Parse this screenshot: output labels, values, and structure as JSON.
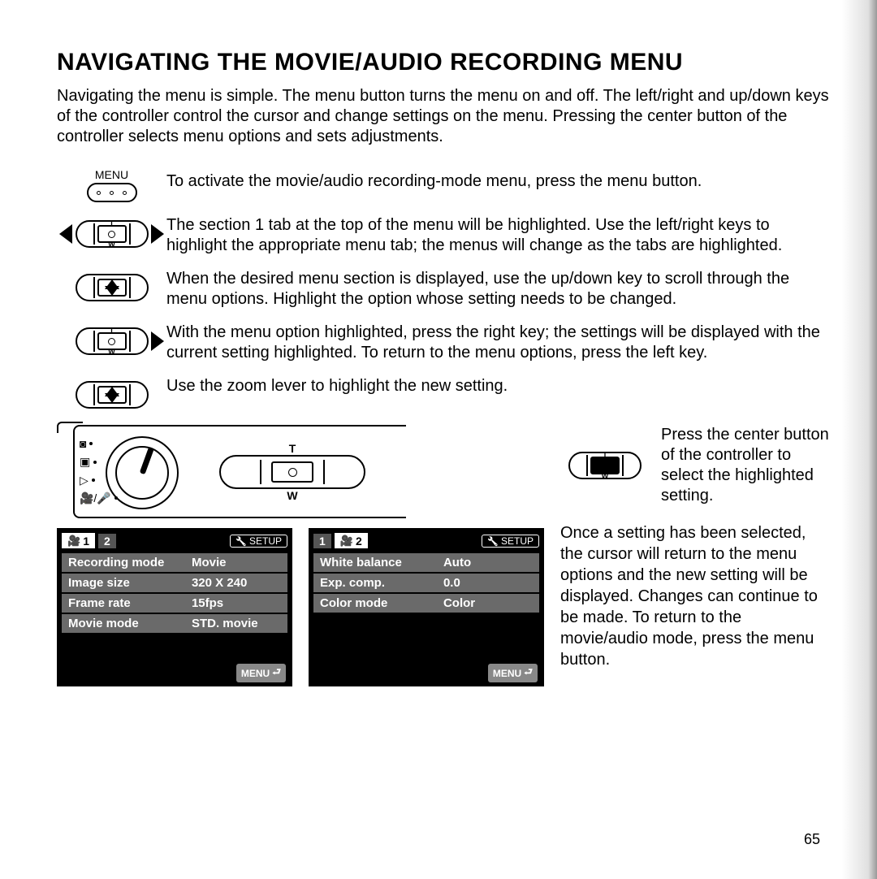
{
  "title": "NAVIGATING THE MOVIE/AUDIO RECORDING MENU",
  "intro": "Navigating the menu is simple. The menu button turns the menu on and off. The left/right and up/down keys of the controller control the cursor and change settings on the menu. Pressing the center button of the controller selects menu options and sets adjustments.",
  "menu_button_label": "MENU",
  "steps": [
    "To activate the movie/audio recording-mode menu, press the menu button.",
    "The section 1 tab at the top of the menu will be highlighted. Use the left/right keys to highlight the appropriate menu tab; the menus will change as the tabs are highlighted.",
    "When the desired menu section is displayed, use the up/down key to scroll through the menu options. Highlight the option whose setting needs to be changed.",
    "With the menu option highlighted, press the right key; the settings will be displayed with the current setting highlighted. To return to the menu options, press the left key.",
    "Use the zoom lever to highlight the new setting."
  ],
  "zoom_labels": {
    "t": "T",
    "w": "W"
  },
  "center_tip": "Press the center button of the controller to select the highlighted setting.",
  "final_text": "Once a setting has been selected, the cursor will return to the menu options and the new setting will be displayed. Changes can continue to be made. To return to the movie/audio mode, press the menu button.",
  "mode_dial_icons": [
    "⦿",
    "📷",
    "▶",
    "🎥/🎤"
  ],
  "screen1": {
    "tab_active": "1",
    "tab_inactive": "2",
    "setup": "SETUP",
    "rows": [
      {
        "k": "Recording mode",
        "v": "Movie"
      },
      {
        "k": "Image size",
        "v": "320 X 240"
      },
      {
        "k": "Frame rate",
        "v": "15fps"
      },
      {
        "k": "Movie mode",
        "v": "STD. movie"
      }
    ],
    "menu_label": "MENU"
  },
  "screen2": {
    "tab_inactive": "1",
    "tab_active": "2",
    "setup": "SETUP",
    "rows": [
      {
        "k": "White balance",
        "v": "Auto"
      },
      {
        "k": "Exp. comp.",
        "v": "0.0"
      },
      {
        "k": "Color mode",
        "v": "Color"
      }
    ],
    "menu_label": "MENU"
  },
  "page_number": "65"
}
